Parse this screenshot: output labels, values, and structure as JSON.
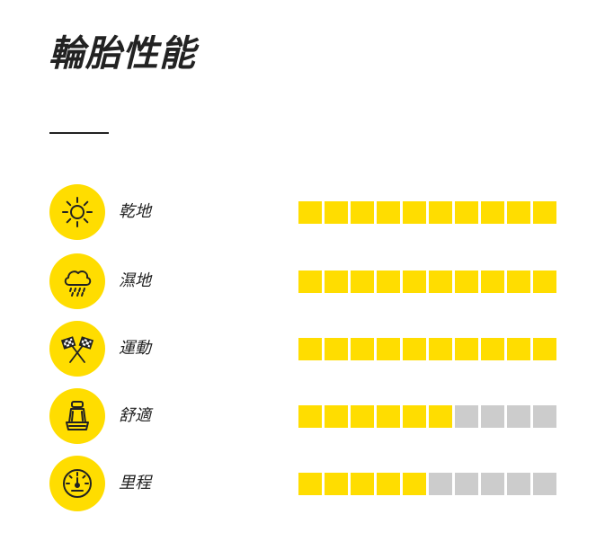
{
  "title": "輪胎性能",
  "colors": {
    "accent": "#ffdd00",
    "inactive": "#cccccc",
    "text": "#222222"
  },
  "ratings": [
    {
      "label": "乾地",
      "icon": "sun-icon",
      "score": 10,
      "max": 10
    },
    {
      "label": "濕地",
      "icon": "rain-cloud-icon",
      "score": 10,
      "max": 10
    },
    {
      "label": "運動",
      "icon": "racing-flags-icon",
      "score": 10,
      "max": 10
    },
    {
      "label": "舒適",
      "icon": "car-seat-icon",
      "score": 6,
      "max": 10
    },
    {
      "label": "里程",
      "icon": "speedometer-icon",
      "score": 5,
      "max": 10
    }
  ]
}
